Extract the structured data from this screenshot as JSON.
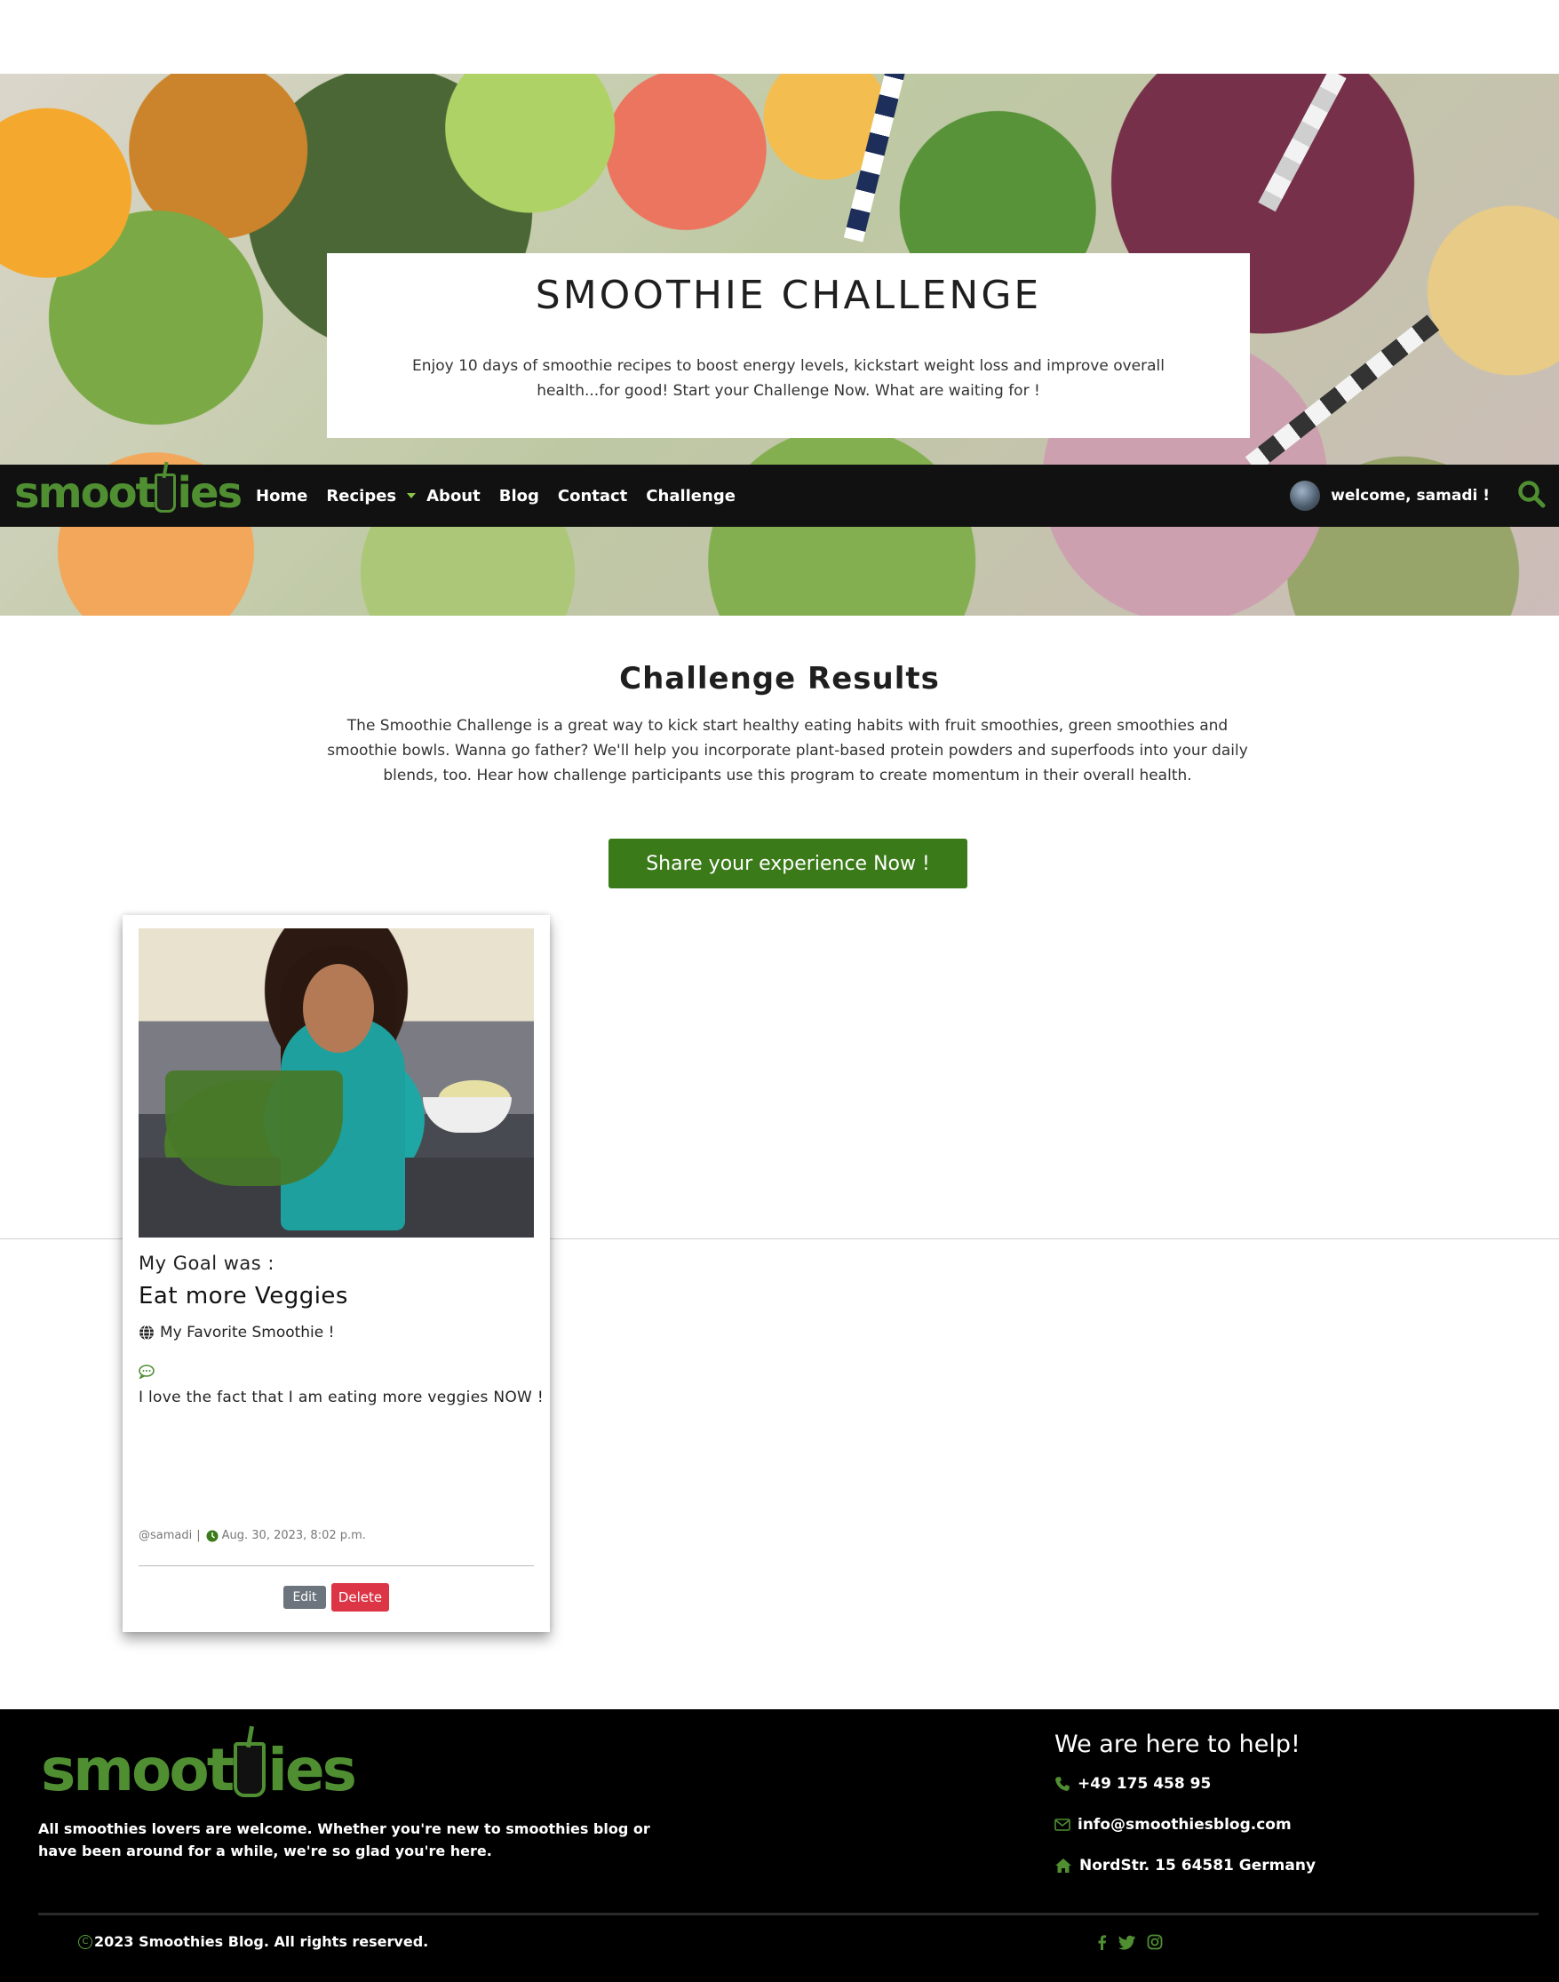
{
  "hero": {
    "title": "SMOOTHIE CHALLENGE",
    "text": "Enjoy 10 days of smoothie recipes to boost energy levels, kickstart weight loss and improve overall health...for good! Start your Challenge Now. What are waiting for !"
  },
  "navbar": {
    "brand_prefix": "smoot",
    "brand_suffix": "ies",
    "links": [
      "Home",
      "Recipes",
      "About",
      "Blog",
      "Contact",
      "Challenge"
    ],
    "welcome": "welcome, samadi !",
    "accent_color": "#4f8f32"
  },
  "section": {
    "title": "Challenge Results",
    "text": "The Smoothie Challenge is a great way to kick start healthy eating habits with fruit smoothies, green smoothies and smoothie bowls. Wanna go father? We'll help you incorporate plant-based protein powders and superfoods into your daily blends, too. Hear how challenge participants use this program to create momentum in their overall health.",
    "share_button": "Share your experience Now !",
    "button_color": "#3a7a18"
  },
  "card": {
    "goal_label": "My Goal was :",
    "goal_title": "Eat more Veggies",
    "favorite": "My Favorite Smoothie !",
    "comment": "I love the fact that I am eating more veggies NOW !",
    "author": "@samadi",
    "separator": "|",
    "date": "Aug. 30, 2023, 8:02 p.m.",
    "edit_label": "Edit",
    "delete_label": "Delete",
    "icons": [
      "globe-icon",
      "comment-icon",
      "clock-icon"
    ]
  },
  "footer": {
    "brand_prefix": "smoot",
    "brand_suffix": "ies",
    "description": "All smoothies lovers are welcome. Whether you're new to smoothies blog or have been around for a while, we're so glad you're here.",
    "help_title": "We are here to help!",
    "phone": "+49 175 458 95",
    "email": "info@smoothiesblog.com",
    "address": "NordStr. 15 64581 Germany",
    "copyright": "2023 Smoothies Blog. All rights reserved.",
    "copyright_symbol": "C",
    "socials": [
      "facebook-icon",
      "twitter-icon",
      "instagram-icon"
    ]
  }
}
